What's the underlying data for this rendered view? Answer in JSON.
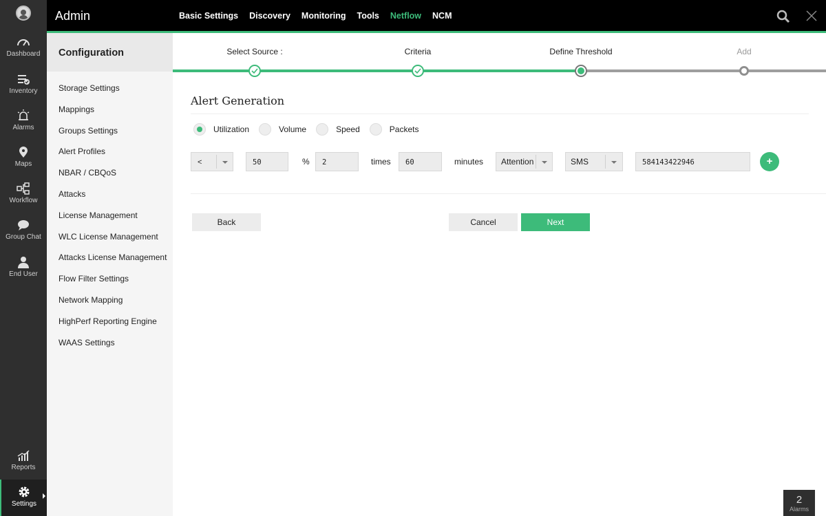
{
  "app": {
    "title": "Admin"
  },
  "topnav": [
    {
      "label": "Basic Settings",
      "active": false
    },
    {
      "label": "Discovery",
      "active": false
    },
    {
      "label": "Monitoring",
      "active": false
    },
    {
      "label": "Tools",
      "active": false
    },
    {
      "label": "Netflow",
      "active": true
    },
    {
      "label": "NCM",
      "active": false
    }
  ],
  "rail": [
    {
      "label": "Dashboard",
      "icon": "gauge-icon"
    },
    {
      "label": "Inventory",
      "icon": "list-check-icon"
    },
    {
      "label": "Alarms",
      "icon": "alarm-bell-icon"
    },
    {
      "label": "Maps",
      "icon": "map-pin-icon"
    },
    {
      "label": "Workflow",
      "icon": "workflow-icon"
    },
    {
      "label": "Group Chat",
      "icon": "chat-bubble-icon"
    },
    {
      "label": "End User",
      "icon": "user-icon"
    },
    {
      "label": "Reports",
      "icon": "chart-icon"
    },
    {
      "label": "Settings",
      "icon": "gear-icon"
    }
  ],
  "config": {
    "title": "Configuration",
    "items": [
      "Storage Settings",
      "Mappings",
      "Groups Settings",
      "Alert Profiles",
      "NBAR / CBQoS",
      "Attacks",
      "License Management",
      "WLC License Management",
      "Attacks License Management",
      "Flow Filter Settings",
      "Network Mapping",
      "HighPerf Reporting Engine",
      "WAAS Settings"
    ]
  },
  "steps": [
    {
      "label": "Select Source :",
      "state": "done"
    },
    {
      "label": "Criteria",
      "state": "done"
    },
    {
      "label": "Define Threshold",
      "state": "current"
    },
    {
      "label": "Add",
      "state": "pending"
    }
  ],
  "alert": {
    "title": "Alert Generation",
    "metrics": [
      {
        "label": "Utilization",
        "checked": true
      },
      {
        "label": "Volume",
        "checked": false
      },
      {
        "label": "Speed",
        "checked": false
      },
      {
        "label": "Packets",
        "checked": false
      }
    ],
    "operator": "<",
    "threshold": "50",
    "percent_label": "%",
    "times": "2",
    "times_label": "times",
    "minutes": "60",
    "minutes_label": "minutes",
    "severity": "Attention",
    "notify": "SMS",
    "phone": "584143422946",
    "add_label": "+"
  },
  "buttons": {
    "back": "Back",
    "cancel": "Cancel",
    "next": "Next"
  },
  "alarms_badge": {
    "count": "2",
    "label": "Alarms"
  },
  "colors": {
    "accent": "#3dbb7a",
    "rail_bg": "#2f2f2f",
    "topbar_bg": "#000000"
  }
}
